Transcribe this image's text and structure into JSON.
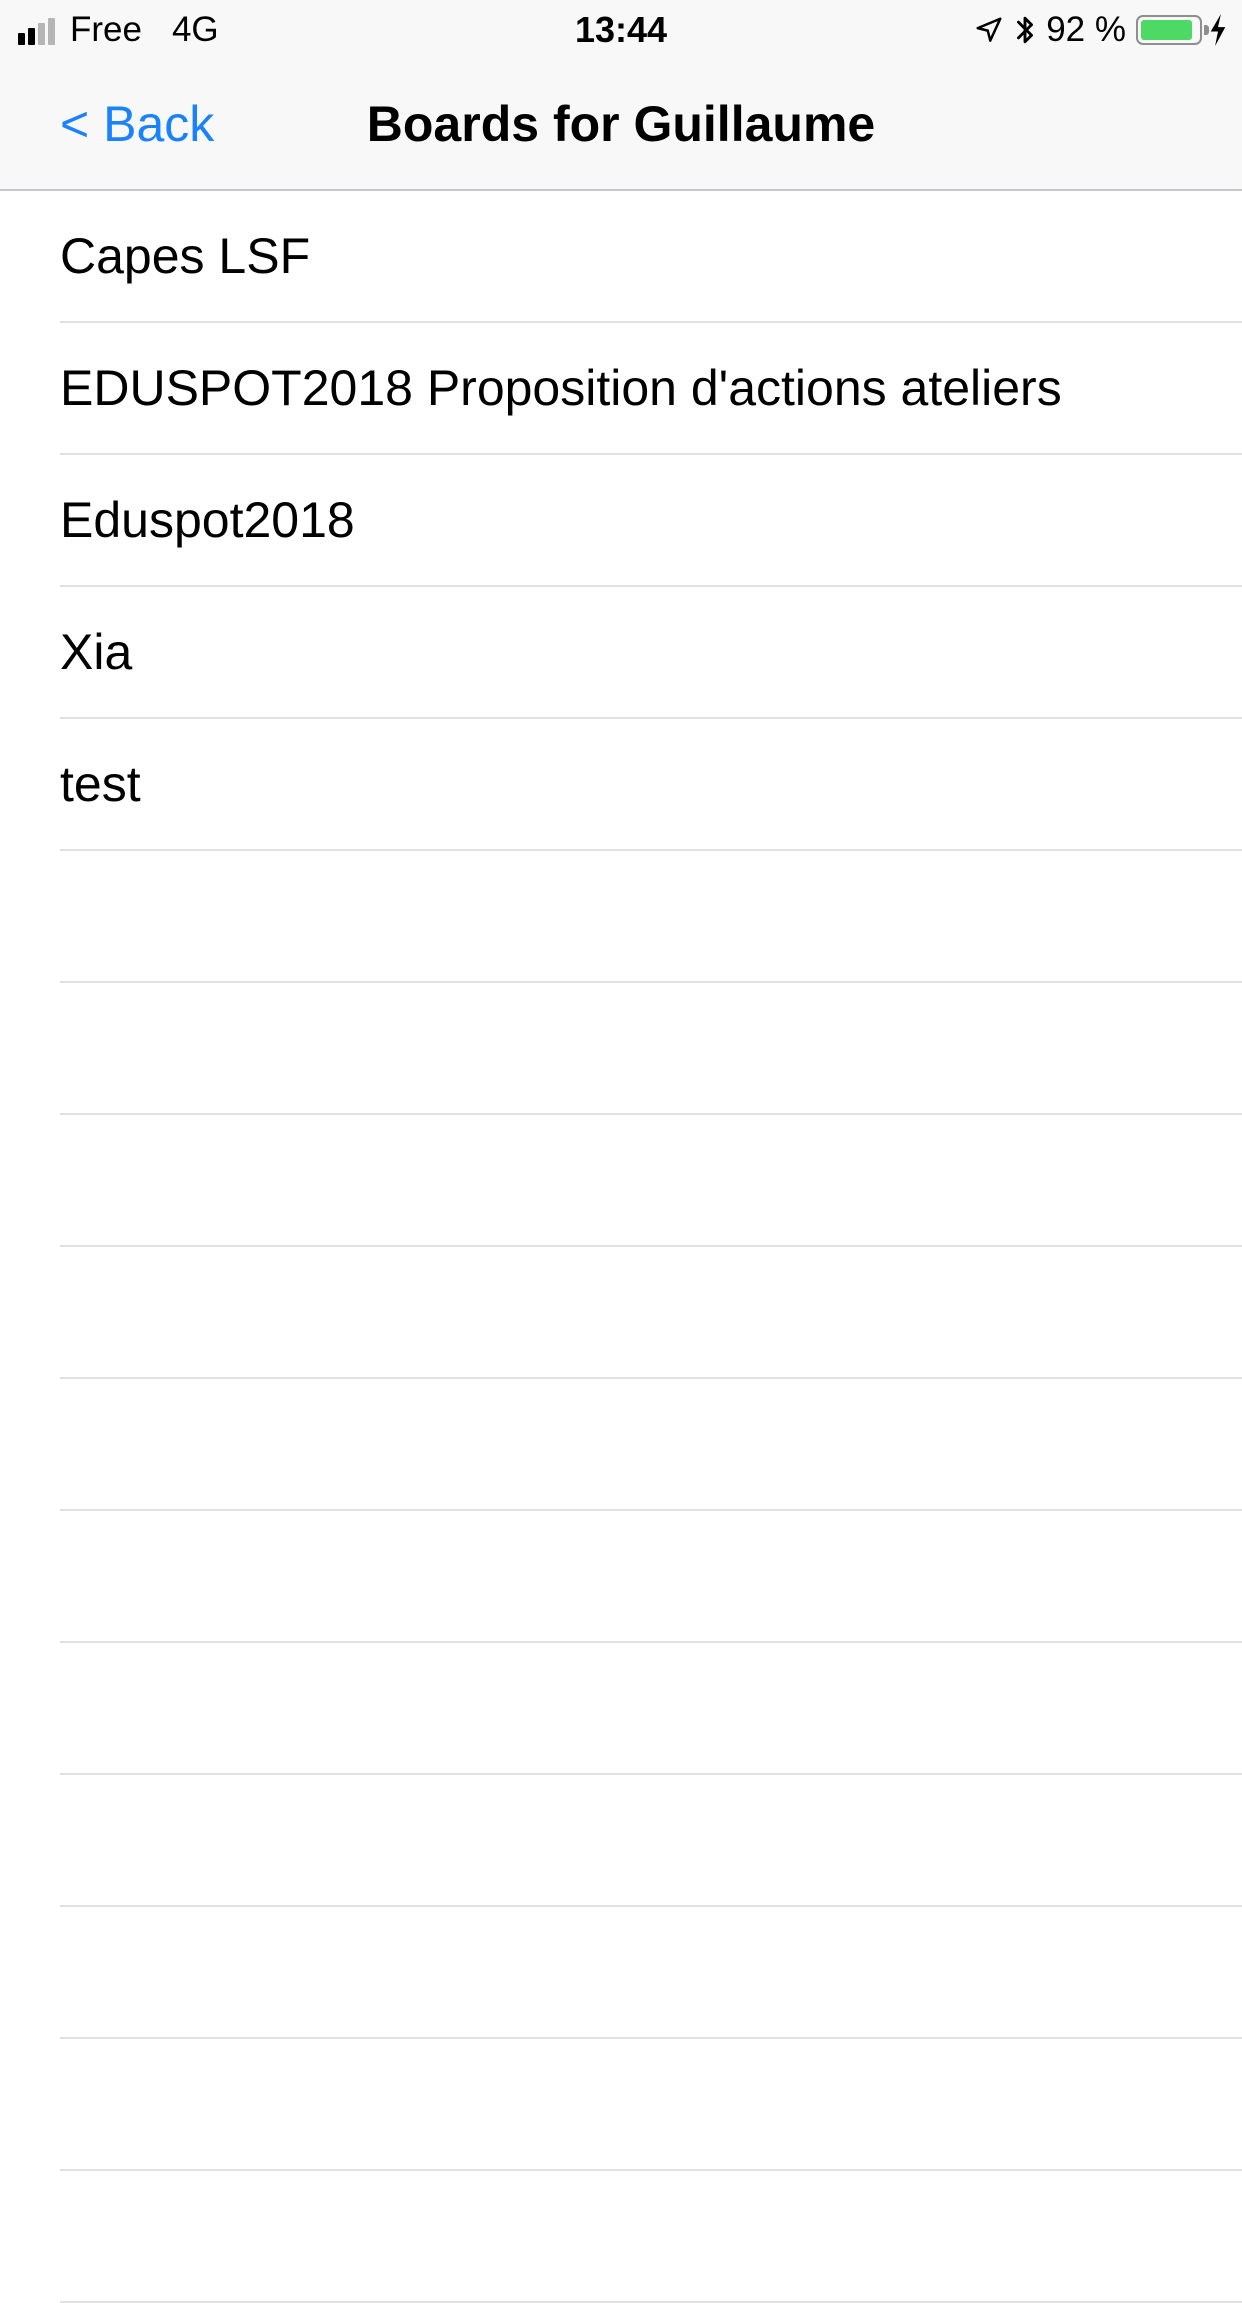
{
  "status_bar": {
    "carrier": "Free",
    "network": "4G",
    "time": "13:44",
    "battery_text": "92 %",
    "battery_level": 0.92,
    "battery_color": "#4cd964",
    "icons": [
      "signal-icon",
      "location-arrow-icon",
      "bluetooth-icon",
      "battery-icon",
      "charging-bolt-icon"
    ]
  },
  "nav": {
    "back_label": "< Back",
    "title": "Boards for Guillaume"
  },
  "boards": [
    "Capes LSF",
    "EDUSPOT2018 Proposition d'actions ateliers",
    "Eduspot2018",
    "Xia",
    "test"
  ],
  "colors": {
    "accent": "#1a82fb",
    "separator": "#e0e0e4",
    "bar_background": "#f8f8f8"
  }
}
